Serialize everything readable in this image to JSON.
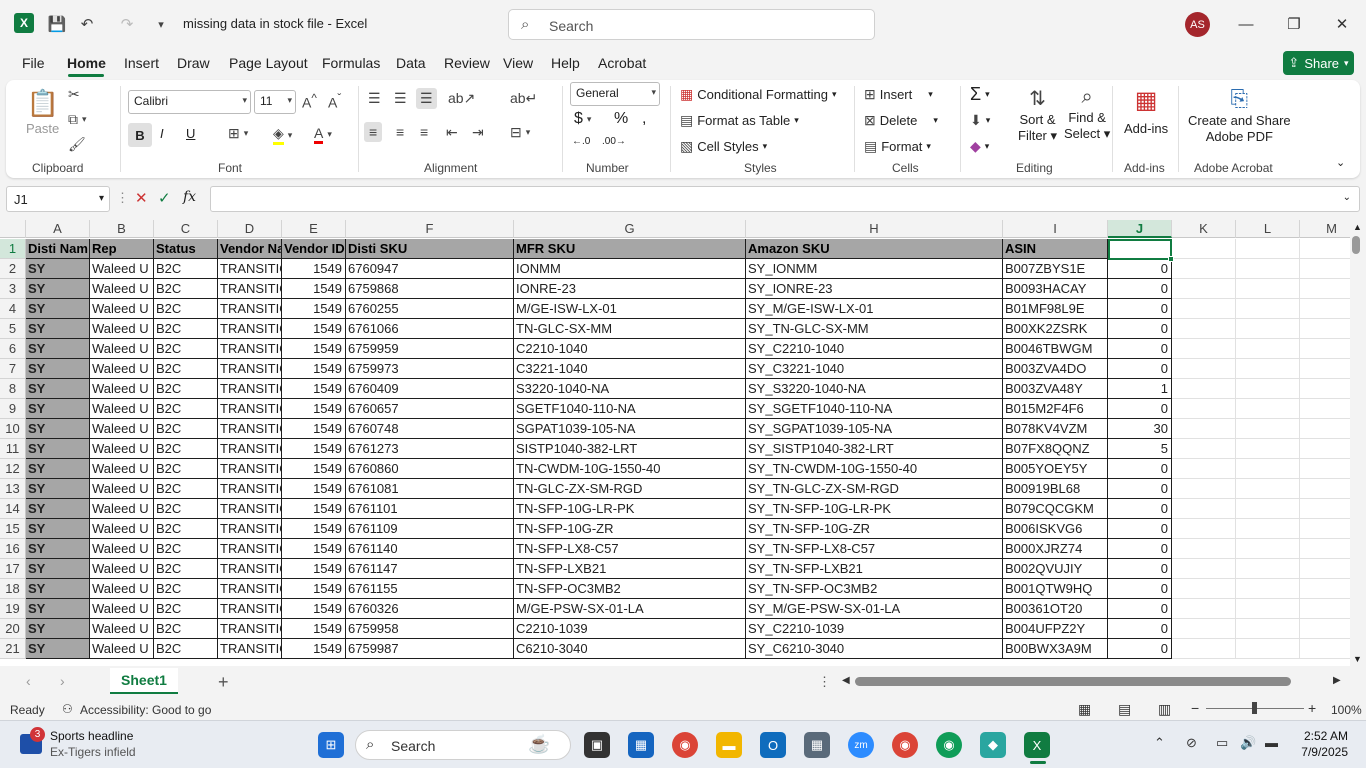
{
  "app": {
    "title": "missing data in stock file  -  Excel",
    "user_initials": "AS",
    "search_placeholder": "Search"
  },
  "menu": [
    "File",
    "Home",
    "Insert",
    "Draw",
    "Page Layout",
    "Formulas",
    "Data",
    "Review",
    "View",
    "Help",
    "Acrobat"
  ],
  "share_label": "Share",
  "ribbon": {
    "clipboard": {
      "paste": "Paste",
      "label": "Clipboard"
    },
    "font": {
      "name": "Calibri",
      "size": "11",
      "label": "Font",
      "bold": "B",
      "italic": "I",
      "underline": "U"
    },
    "alignment": {
      "label": "Alignment"
    },
    "number": {
      "format": "General",
      "label": "Number",
      "currency": "$",
      "percent": "%"
    },
    "styles": {
      "conditional": "Conditional Formatting",
      "format_table": "Format as Table",
      "cell_styles": "Cell Styles",
      "label": "Styles"
    },
    "cells": {
      "insert": "Insert",
      "delete": "Delete",
      "format": "Format",
      "label": "Cells"
    },
    "editing": {
      "sort": "Sort &",
      "sort2": "Filter",
      "find": "Find &",
      "find2": "Select",
      "label": "Editing"
    },
    "addins": {
      "button": "Add-ins",
      "label": "Add-ins"
    },
    "acrobat": {
      "button1": "Create and Share",
      "button2": "Adobe PDF",
      "label": "Adobe Acrobat"
    }
  },
  "namebox": "J1",
  "columns": [
    "A",
    "B",
    "C",
    "D",
    "E",
    "F",
    "G",
    "H",
    "I",
    "J",
    "K",
    "L",
    "M"
  ],
  "headers": [
    "Disti Nam",
    "Rep",
    "Status",
    "Vendor Na",
    "Vendor ID",
    "Disti SKU",
    "MFR SKU",
    "Amazon SKU",
    "ASIN",
    ""
  ],
  "rows": [
    [
      "SY",
      "Waleed U",
      "B2C",
      "TRANSITIO",
      "1549",
      "6760947",
      "IONMM",
      "SY_IONMM",
      "B007ZBYS1E",
      "0"
    ],
    [
      "SY",
      "Waleed U",
      "B2C",
      "TRANSITIO",
      "1549",
      "6759868",
      "IONRE-23",
      "SY_IONRE-23",
      "B0093HACAY",
      "0"
    ],
    [
      "SY",
      "Waleed U",
      "B2C",
      "TRANSITIO",
      "1549",
      "6760255",
      "M/GE-ISW-LX-01",
      "SY_M/GE-ISW-LX-01",
      "B01MF98L9E",
      "0"
    ],
    [
      "SY",
      "Waleed U",
      "B2C",
      "TRANSITIO",
      "1549",
      "6761066",
      "TN-GLC-SX-MM",
      "SY_TN-GLC-SX-MM",
      "B00XK2ZSRK",
      "0"
    ],
    [
      "SY",
      "Waleed U",
      "B2C",
      "TRANSITIO",
      "1549",
      "6759959",
      "C2210-1040",
      "SY_C2210-1040",
      "B0046TBWGM",
      "0"
    ],
    [
      "SY",
      "Waleed U",
      "B2C",
      "TRANSITIO",
      "1549",
      "6759973",
      "C3221-1040",
      "SY_C3221-1040",
      "B003ZVA4DO",
      "0"
    ],
    [
      "SY",
      "Waleed U",
      "B2C",
      "TRANSITIO",
      "1549",
      "6760409",
      "S3220-1040-NA",
      "SY_S3220-1040-NA",
      "B003ZVA48Y",
      "1"
    ],
    [
      "SY",
      "Waleed U",
      "B2C",
      "TRANSITIO",
      "1549",
      "6760657",
      "SGETF1040-110-NA",
      "SY_SGETF1040-110-NA",
      "B015M2F4F6",
      "0"
    ],
    [
      "SY",
      "Waleed U",
      "B2C",
      "TRANSITIO",
      "1549",
      "6760748",
      "SGPAT1039-105-NA",
      "SY_SGPAT1039-105-NA",
      "B078KV4VZM",
      "30"
    ],
    [
      "SY",
      "Waleed U",
      "B2C",
      "TRANSITIO",
      "1549",
      "6761273",
      "SISTP1040-382-LRT",
      "SY_SISTP1040-382-LRT",
      "B07FX8QQNZ",
      "5"
    ],
    [
      "SY",
      "Waleed U",
      "B2C",
      "TRANSITIO",
      "1549",
      "6760860",
      "TN-CWDM-10G-1550-40",
      "SY_TN-CWDM-10G-1550-40",
      "B005YOEY5Y",
      "0"
    ],
    [
      "SY",
      "Waleed U",
      "B2C",
      "TRANSITIO",
      "1549",
      "6761081",
      "TN-GLC-ZX-SM-RGD",
      "SY_TN-GLC-ZX-SM-RGD",
      "B00919BL68",
      "0"
    ],
    [
      "SY",
      "Waleed U",
      "B2C",
      "TRANSITIO",
      "1549",
      "6761101",
      "TN-SFP-10G-LR-PK",
      "SY_TN-SFP-10G-LR-PK",
      "B079CQCGKM",
      "0"
    ],
    [
      "SY",
      "Waleed U",
      "B2C",
      "TRANSITIO",
      "1549",
      "6761109",
      "TN-SFP-10G-ZR",
      "SY_TN-SFP-10G-ZR",
      "B006ISKVG6",
      "0"
    ],
    [
      "SY",
      "Waleed U",
      "B2C",
      "TRANSITIO",
      "1549",
      "6761140",
      "TN-SFP-LX8-C57",
      "SY_TN-SFP-LX8-C57",
      "B000XJRZ74",
      "0"
    ],
    [
      "SY",
      "Waleed U",
      "B2C",
      "TRANSITIO",
      "1549",
      "6761147",
      "TN-SFP-LXB21",
      "SY_TN-SFP-LXB21",
      "B002QVUJIY",
      "0"
    ],
    [
      "SY",
      "Waleed U",
      "B2C",
      "TRANSITIO",
      "1549",
      "6761155",
      "TN-SFP-OC3MB2",
      "SY_TN-SFP-OC3MB2",
      "B001QTW9HQ",
      "0"
    ],
    [
      "SY",
      "Waleed U",
      "B2C",
      "TRANSITIO",
      "1549",
      "6760326",
      "M/GE-PSW-SX-01-LA",
      "SY_M/GE-PSW-SX-01-LA",
      "B00361OT20",
      "0"
    ],
    [
      "SY",
      "Waleed U",
      "B2C",
      "TRANSITIO",
      "1549",
      "6759958",
      "C2210-1039",
      "SY_C2210-1039",
      "B004UFPZ2Y",
      "0"
    ],
    [
      "SY",
      "Waleed U",
      "B2C",
      "TRANSITIO",
      "1549",
      "6759987",
      "C6210-3040",
      "SY_C6210-3040",
      "B00BWX3A9M",
      "0"
    ]
  ],
  "sheet_tab": "Sheet1",
  "status": {
    "ready": "Ready",
    "accessibility": "Accessibility: Good to go",
    "zoom": "100%"
  },
  "taskbar": {
    "news_title": "Sports headline",
    "news_sub": "Ex-Tigers infield",
    "news_badge": "3",
    "search": "Search",
    "time": "2:52 AM",
    "date": "7/9/2025"
  }
}
